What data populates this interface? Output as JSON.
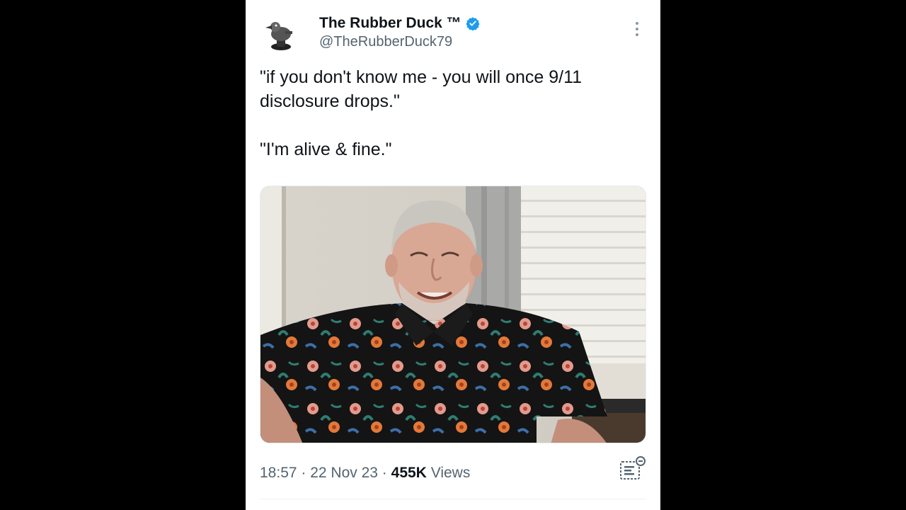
{
  "tweet": {
    "display_name": "The Rubber Duck ™",
    "handle": "@TheRubberDuck79",
    "verified": true,
    "paragraph_1": "\"if you don't know me - you will once 9/11 disclosure drops.\"",
    "paragraph_2": "\"I'm alive & fine.\"",
    "time": "18:57",
    "date": "22 Nov 23",
    "views_count": "455K",
    "views_label": "Views"
  },
  "icons": {
    "verified": "verified-badge-icon",
    "more": "more-options-icon",
    "analytics": "post-analytics-icon",
    "avatar": "avatar-duck"
  },
  "colors": {
    "background": "#000000",
    "card": "#ffffff",
    "text": "#0f1419",
    "secondary_text": "#536471",
    "verified_blue": "#1d9bf0"
  }
}
